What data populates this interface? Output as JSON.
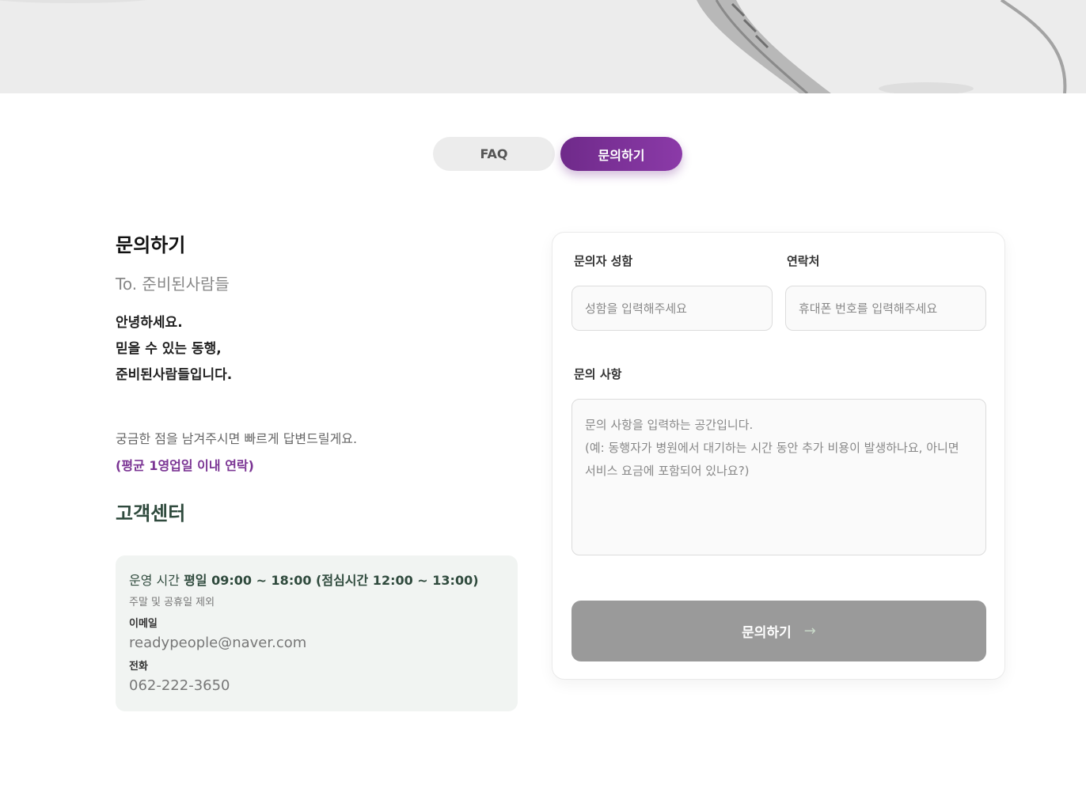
{
  "tabs": {
    "faq": "FAQ",
    "inquiry": "문의하기"
  },
  "intro": {
    "title": "문의하기",
    "to": "To. 준비된사람들",
    "greeting": [
      "안녕하세요.",
      "믿을 수 있는 동행,",
      "준비된사람들입니다."
    ],
    "description": "궁금한 점을 남겨주시면 빠르게 답변드릴게요.",
    "highlight": "(평균 1영업일 이내 연락)"
  },
  "customer_center": {
    "title": "고객센터",
    "hours_label": "운영 시간",
    "hours_value": "평일 09:00 ~ 18:00 (점심시간 12:00 ~ 13:00)",
    "hours_note": "주말 및 공휴일 제외",
    "email_label": "이메일",
    "email_value": "readypeople@naver.com",
    "phone_label": "전화",
    "phone_value": "062-222-3650"
  },
  "form": {
    "name_label": "문의자 성함",
    "name_placeholder": "성함을 입력해주세요",
    "contact_label": "연락처",
    "contact_placeholder": "휴대폰 번호를 입력해주세요",
    "message_label": "문의 사항",
    "message_placeholder": "문의 사항을 입력하는 공간입니다.\n(예: 동행자가 병원에서 대기하는 시간 동안 추가 비용이 발생하나요, 아니면 서비스 요금에 포함되어 있나요?)",
    "submit_label": "문의하기",
    "submit_icon": "arrow-right-icon"
  },
  "colors": {
    "accent": "#7b3594",
    "dark_green": "#2f4a3d",
    "submit_disabled": "#9a9a9a"
  }
}
